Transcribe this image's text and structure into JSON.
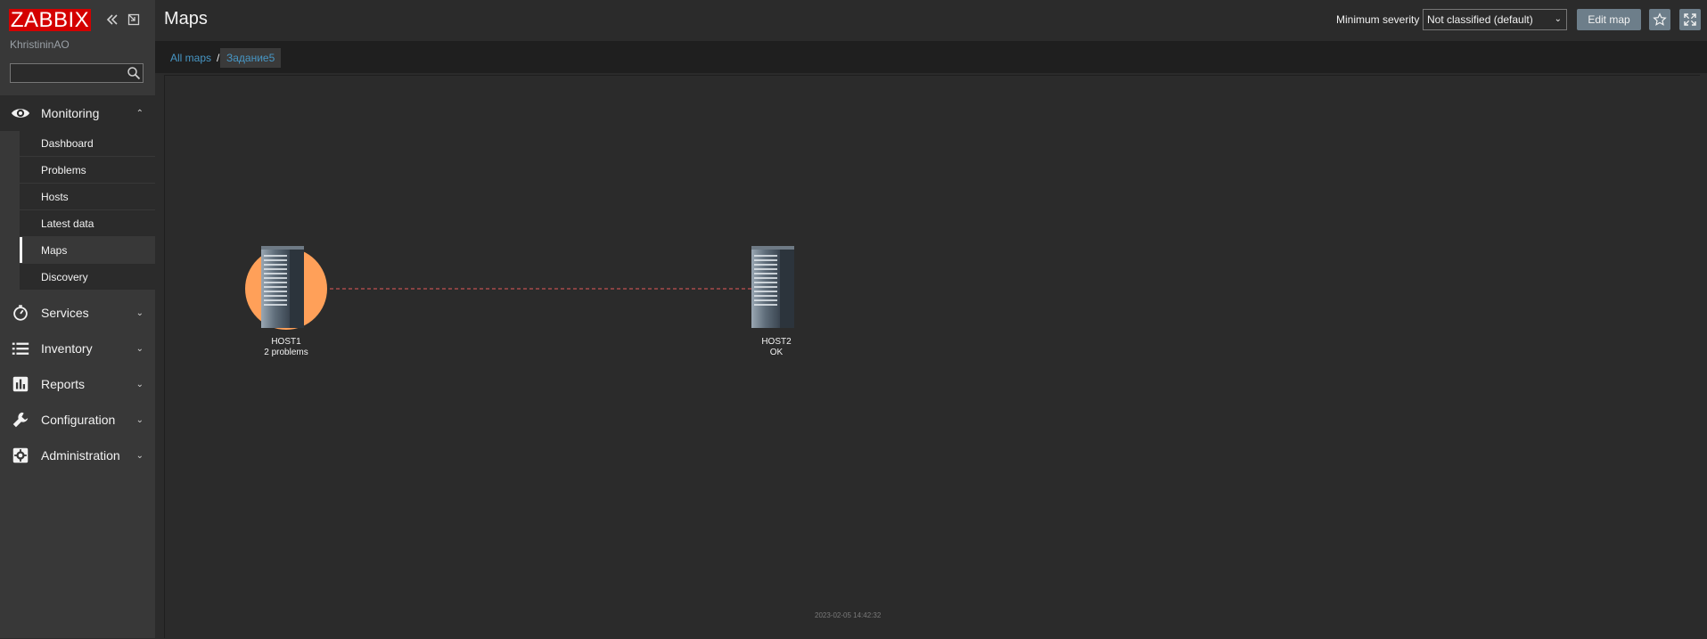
{
  "app": {
    "logo": "ZABBIX",
    "username": "KhristininAO"
  },
  "sidebar": {
    "search_placeholder": "",
    "menu": [
      {
        "label": "Monitoring",
        "icon": "eye-icon",
        "expanded": true
      },
      {
        "label": "Services",
        "icon": "stopwatch-icon"
      },
      {
        "label": "Inventory",
        "icon": "list-icon"
      },
      {
        "label": "Reports",
        "icon": "bar-chart-icon"
      },
      {
        "label": "Configuration",
        "icon": "wrench-icon"
      },
      {
        "label": "Administration",
        "icon": "gear-icon"
      }
    ],
    "monitoring_items": [
      {
        "label": "Dashboard"
      },
      {
        "label": "Problems"
      },
      {
        "label": "Hosts"
      },
      {
        "label": "Latest data"
      },
      {
        "label": "Maps",
        "selected": true
      },
      {
        "label": "Discovery"
      }
    ]
  },
  "header": {
    "title": "Maps",
    "min_severity_label": "Minimum severity",
    "min_severity_value": "Not classified (default)",
    "edit_map_label": "Edit map"
  },
  "breadcrumb": {
    "all_maps": "All maps",
    "separator": "/",
    "current": "Задание5"
  },
  "map": {
    "hosts": [
      {
        "name": "HOST1",
        "status": "2 problems",
        "status_color": "#e45959",
        "highlight": "#ffa059"
      },
      {
        "name": "HOST2",
        "status": "OK",
        "status_color": "#00aa00"
      }
    ],
    "link_color": "#e45959",
    "timestamp": "2023-02-05 14:42:32"
  },
  "colors": {
    "accent_link": "#4796c4",
    "logo_bg": "#d40000",
    "button_bg": "#6d7e8a"
  }
}
